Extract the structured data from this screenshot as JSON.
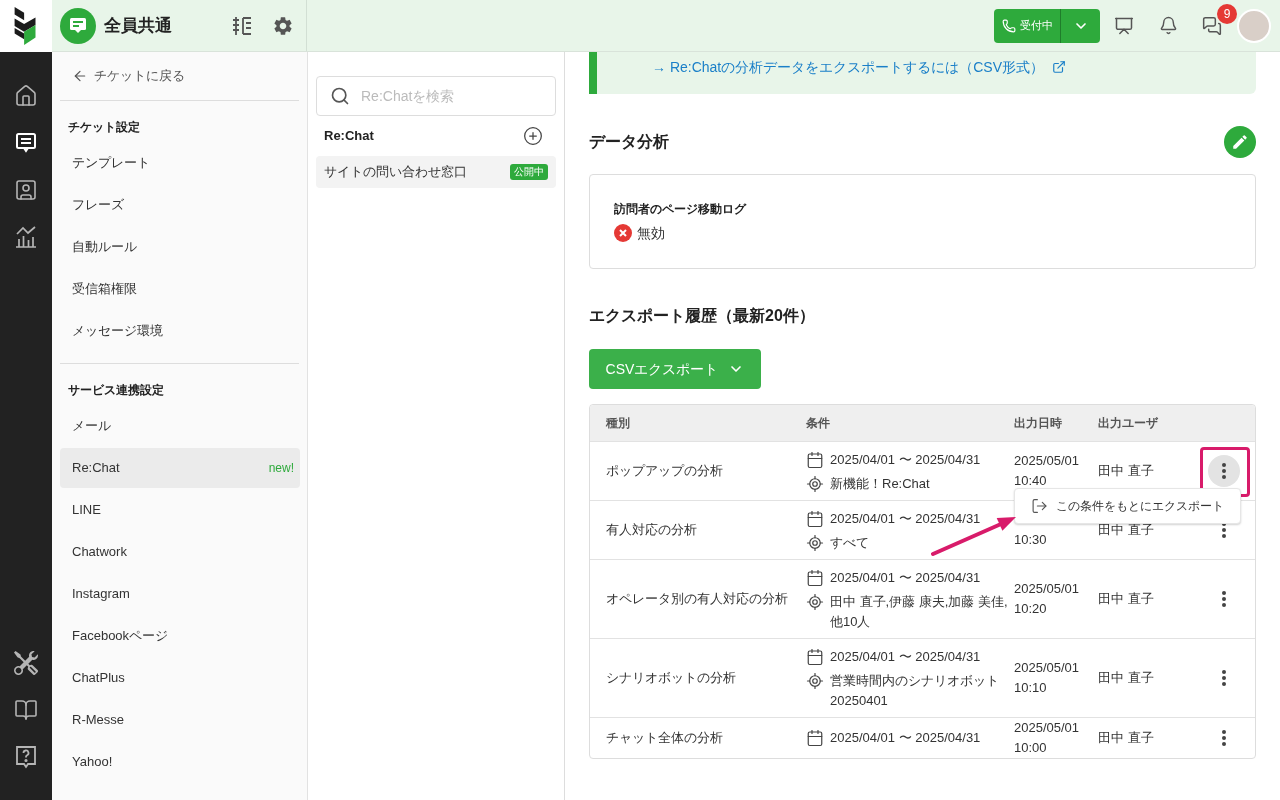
{
  "rail": {
    "top_items": [
      {
        "kind": "home",
        "selected": false
      },
      {
        "kind": "ticket",
        "selected": true
      },
      {
        "kind": "contacts",
        "selected": false
      },
      {
        "kind": "analytics",
        "selected": false
      }
    ],
    "bottom_items": [
      {
        "kind": "tools",
        "selected": false
      },
      {
        "kind": "manual",
        "selected": false
      },
      {
        "kind": "help",
        "selected": false
      }
    ]
  },
  "header": {
    "workspace": "全員共通",
    "status_button": "受付中",
    "notification_count": "9"
  },
  "settings_sidebar": {
    "back_link": "チケットに戻る",
    "sections": [
      {
        "heading": "チケット設定",
        "items": [
          {
            "label": "テンプレート",
            "selected": false
          },
          {
            "label": "フレーズ",
            "selected": false
          },
          {
            "label": "自動ルール",
            "selected": false
          },
          {
            "label": "受信箱権限",
            "selected": false
          },
          {
            "label": "メッセージ環境",
            "selected": false
          }
        ]
      },
      {
        "heading": "サービス連携設定",
        "items": [
          {
            "label": "メール",
            "selected": false
          },
          {
            "label": "Re:Chat",
            "selected": true,
            "badge": "new!"
          },
          {
            "label": "LINE",
            "selected": false
          },
          {
            "label": "Chatwork",
            "selected": false
          },
          {
            "label": "Instagram",
            "selected": false
          },
          {
            "label": "Facebookページ",
            "selected": false
          },
          {
            "label": "ChatPlus",
            "selected": false
          },
          {
            "label": "R-Messe",
            "selected": false
          },
          {
            "label": "Yahoo!",
            "selected": false
          }
        ]
      }
    ]
  },
  "channel_panel": {
    "search": {
      "placeholder": "Re:Chatを検索"
    },
    "heading": "Re:Chat",
    "items": [
      {
        "label": "サイトの問い合わせ窓口",
        "status": "公開中",
        "selected": true
      }
    ]
  },
  "main": {
    "guide_link": "→ Re:Chatの分析データをエクスポートするには（CSV形式）",
    "data_analysis": {
      "title": "データ分析",
      "settings": [
        {
          "label": "訪問者のページ移動ログ",
          "enabled": false,
          "status": "無効"
        }
      ]
    },
    "export_history": {
      "title": "エクスポート履歴（最新20件）",
      "export_button": "CSVエクスポート",
      "table": {
        "columns": [
          "種別",
          "条件",
          "出力日時",
          "出力ユーザ"
        ],
        "rows": [
          {
            "type": "ポップアップの分析",
            "period": "2025/04/01 〜 2025/04/31",
            "target": "新機能！Re:Chat",
            "date": "2025/05/01",
            "time": "10:40",
            "user": "田中 直子",
            "menu_open": true
          },
          {
            "type": "有人対応の分析",
            "period": "2025/04/01 〜 2025/04/31",
            "target": "すべて",
            "time": "10:30",
            "user": "田中 直子",
            "menu_open": false
          },
          {
            "type": "オペレータ別の有人対応の分析",
            "period": "2025/04/01 〜 2025/04/31",
            "target": "田中 直子,伊藤 康夫,加藤 美佳,他10人",
            "date": "2025/05/01",
            "time": "10:20",
            "user": "田中 直子",
            "menu_open": false
          },
          {
            "type": "シナリオボットの分析",
            "period": "2025/04/01 〜 2025/04/31",
            "target": "営業時間内のシナリオボット 20250401",
            "date": "2025/05/01",
            "time": "10:10",
            "user": "田中 直子",
            "menu_open": false
          },
          {
            "type": "チャット全体の分析",
            "period": "2025/04/01 〜 2025/04/31",
            "date": "2025/05/01",
            "time": "10:00",
            "user": "田中 直子",
            "menu_open": false
          }
        ]
      },
      "row_menu": {
        "items": [
          "この条件をもとにエクスポート"
        ]
      }
    }
  }
}
